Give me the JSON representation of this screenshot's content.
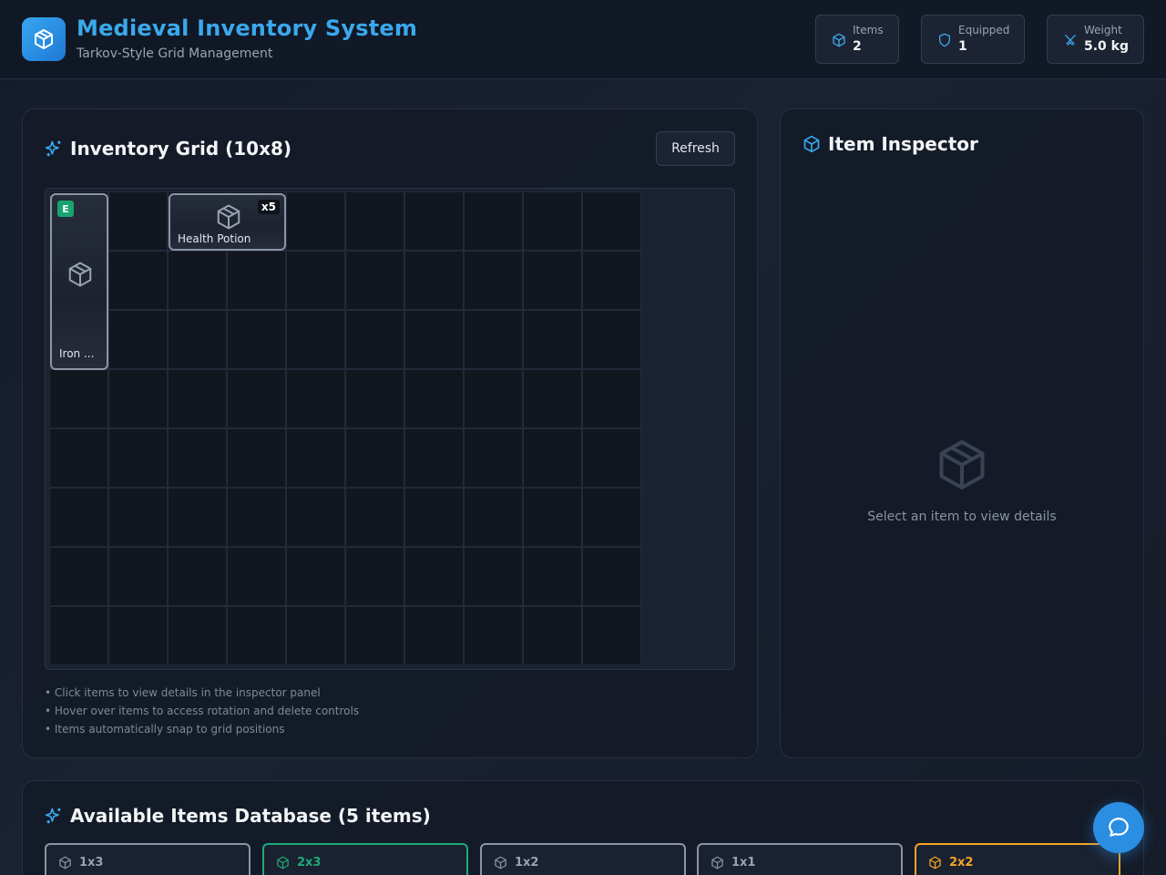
{
  "header": {
    "title": "Medieval Inventory System",
    "subtitle": "Tarkov-Style Grid Management",
    "stats": [
      {
        "label": "Items",
        "value": "2",
        "icon": "box-icon"
      },
      {
        "label": "Equipped",
        "value": "1",
        "icon": "shield-icon"
      },
      {
        "label": "Weight",
        "value": "5.0 kg",
        "icon": "swords-icon"
      }
    ]
  },
  "inventory": {
    "title": "Inventory Grid (10x8)",
    "refresh_label": "Refresh",
    "items": [
      {
        "name": "Iron ...",
        "equipped_badge": "E"
      },
      {
        "name": "Health Potion",
        "quantity": "x5"
      }
    ],
    "tips": [
      "• Click items to view details in the inspector panel",
      "• Hover over items to access rotation and delete controls",
      "• Items automatically snap to grid positions"
    ]
  },
  "inspector": {
    "title": "Item Inspector",
    "empty_text": "Select an item to view details"
  },
  "database": {
    "title": "Available Items Database (5 items)",
    "cards": [
      {
        "size": "1x3",
        "accent": "#8c95a5"
      },
      {
        "size": "2x3",
        "accent": "#1faa78"
      },
      {
        "size": "1x2",
        "accent": "#8c95a5"
      },
      {
        "size": "1x1",
        "accent": "#8c95a5"
      },
      {
        "size": "2x2",
        "accent": "#f5a524"
      }
    ]
  },
  "colors": {
    "accent": "#3aa8ec",
    "equipped": "#19a36f",
    "legendary": "#f5a524"
  }
}
